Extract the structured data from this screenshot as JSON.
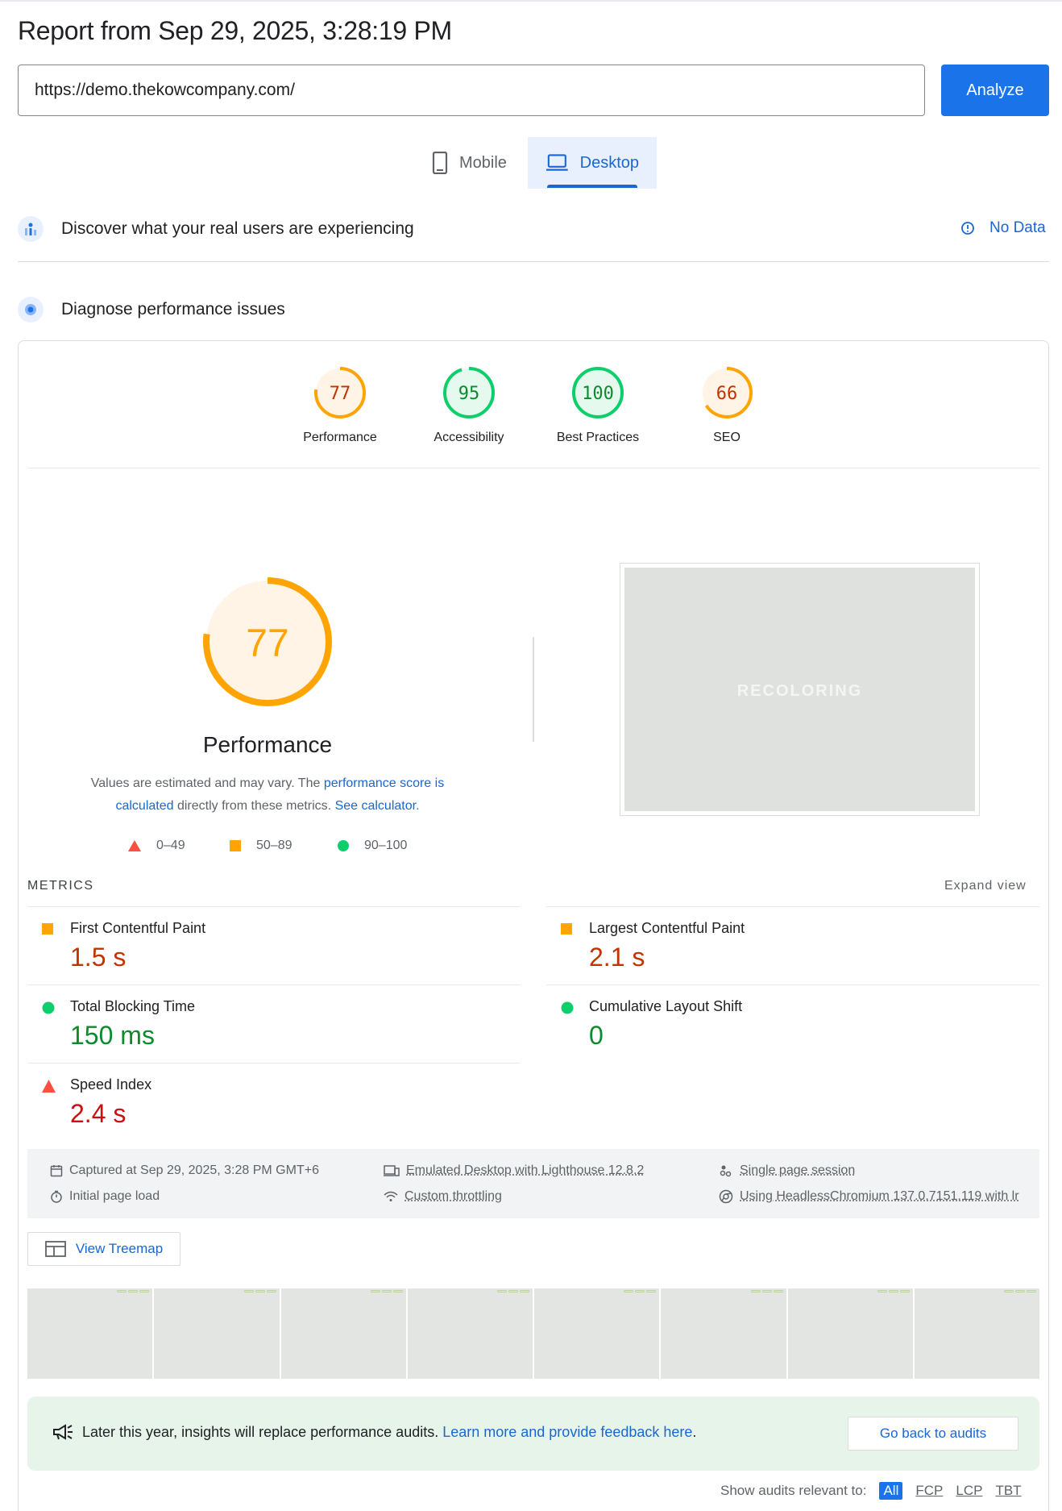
{
  "header": {
    "title": "Report from Sep 29, 2025, 3:28:19 PM",
    "url_value": "https://demo.thekowcompany.com/",
    "analyze_label": "Analyze"
  },
  "device_tabs": {
    "mobile_label": "Mobile",
    "desktop_label": "Desktop"
  },
  "field_data": {
    "heading": "Discover what your real users are experiencing",
    "status": "No Data"
  },
  "diagnose": {
    "heading": "Diagnose performance issues"
  },
  "scores": [
    {
      "label": "Performance",
      "value": "77",
      "fraction": 0.77,
      "color": "#ffa400",
      "text_color": "#c33300",
      "fill": "#fff4e5"
    },
    {
      "label": "Accessibility",
      "value": "95",
      "fraction": 0.95,
      "color": "#0cce6b",
      "text_color": "#0c8a2e",
      "fill": "#e6f9ee"
    },
    {
      "label": "Best Practices",
      "value": "100",
      "fraction": 1.0,
      "color": "#0cce6b",
      "text_color": "#0c8a2e",
      "fill": "#e6f9ee"
    },
    {
      "label": "SEO",
      "value": "66",
      "fraction": 0.66,
      "color": "#ffa400",
      "text_color": "#c33300",
      "fill": "#fff4e5"
    }
  ],
  "performance": {
    "score": "77",
    "fraction": 0.77,
    "label": "Performance",
    "note_prefix": "Values are estimated and may vary. The ",
    "note_link1": "performance score is calculated",
    "note_mid": " directly from these metrics. ",
    "note_link2": "See calculator",
    "note_suffix": "."
  },
  "legend": {
    "fail": "0–49",
    "average": "50–89",
    "pass": "90–100"
  },
  "screenshot": {
    "overlay_text": "RECOLORING"
  },
  "metrics": {
    "heading": "METRICS",
    "expand_label": "Expand view",
    "items": [
      {
        "name": "First Contentful Paint",
        "value": "1.5 s",
        "rating": "average"
      },
      {
        "name": "Largest Contentful Paint",
        "value": "2.1 s",
        "rating": "average"
      },
      {
        "name": "Total Blocking Time",
        "value": "150 ms",
        "rating": "pass"
      },
      {
        "name": "Cumulative Layout Shift",
        "value": "0",
        "rating": "pass"
      },
      {
        "name": "Speed Index",
        "value": "2.4 s",
        "rating": "fail"
      }
    ]
  },
  "environment": {
    "captured": "Captured at Sep 29, 2025, 3:28 PM GMT+6",
    "initial_load": "Initial page load",
    "emulated": "Emulated Desktop with Lighthouse 12.8.2",
    "throttling": "Custom throttling",
    "session": "Single page session",
    "browser": "Using HeadlessChromium 137.0.7151.119 with lr"
  },
  "treemap_label": "View Treemap",
  "insights": {
    "text": "Later this year, insights will replace performance audits. ",
    "link": "Learn more and provide feedback here",
    "suffix": ".",
    "back_label": "Go back to audits"
  },
  "audit_filter": {
    "label": "Show audits relevant to:",
    "options": [
      "All",
      "FCP",
      "LCP",
      "TBT"
    ]
  },
  "colors": {
    "accent": "#1a73e8",
    "average": "#ffa400",
    "pass": "#0cce6b",
    "fail": "#ff4e42"
  }
}
